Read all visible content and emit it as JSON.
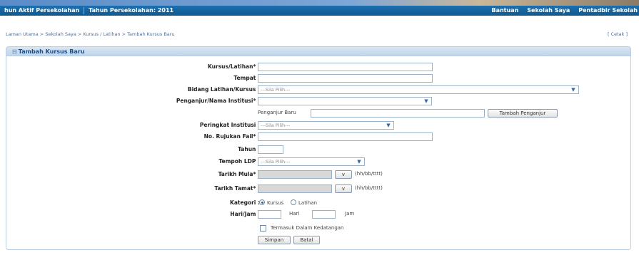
{
  "navbar": {
    "active_year_label": "hun Aktif Persekolahan",
    "school_year": "Tahun Persekolahan: 2011",
    "links": [
      "Bantuan",
      "Sekolah Saya",
      "Pentadbir Sekolah"
    ]
  },
  "breadcrumb": {
    "text": "Laman Utama > Sekolah Saya > Kursus / Latihan > Tambah Kursus Baru",
    "print": "[ Cetak ]"
  },
  "panel": {
    "title": "Tambah Kursus Baru"
  },
  "form": {
    "kursus_label": "Kursus/Latihan* :",
    "tempat_label": "Tempat :",
    "bidang_label": "Bidang Latihan/Kursus :",
    "bidang_value": "---Sila Pilih---",
    "penganjur_label": "Penganjur/Nama Institusi* :",
    "penganjur_baru_label": "Penganjur Baru",
    "tambah_penganjur": "Tambah Penganjur",
    "peringkat_label": "Peringkat Institusi :",
    "peringkat_value": "---Sila Pilih---",
    "rujukan_label": "No. Rujukan Fail* :",
    "tahun_label": "Tahun :",
    "tempoh_label": "Tempoh LDP :",
    "tempoh_value": "---Sila Pilih---",
    "mula_label": "Tarikh Mula* :",
    "tamat_label": "Tarikh Tamat* :",
    "date_format": "(hh/bb/tttt)",
    "date_button": "v",
    "kategori_label": "Kategori :",
    "kategori_options": [
      "Kursus",
      "Latihan"
    ],
    "harijam_label": "Hari/Jam :",
    "hari": "Hari",
    "jam": "Jam",
    "kedatangan": "Termasuk Dalam Kedatangan",
    "simpan": "Simpan",
    "batal": "Batal"
  }
}
